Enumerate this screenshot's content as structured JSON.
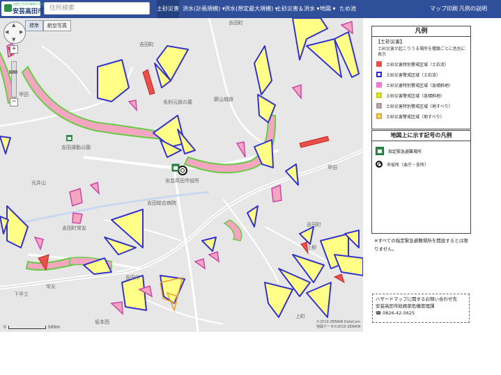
{
  "header": {
    "logo_subtitle": "自然と生活の調和する安芸高田市",
    "logo_text": "安芸高田市",
    "search_placeholder": "住所検索",
    "nav": [
      {
        "label": "土砂災害"
      },
      {
        "label": "洪水(計画規模) ▾"
      },
      {
        "label": "洪水(想定最大規模) ▾"
      },
      {
        "label": "土砂災害＆洪水 ▾"
      },
      {
        "label": "地図 ▾"
      },
      {
        "label": "ため池"
      }
    ],
    "right_nav": [
      {
        "label": "マップ印刷"
      },
      {
        "label": "凡例の説明"
      }
    ]
  },
  "map": {
    "basemap_tabs": [
      {
        "label": "標準"
      },
      {
        "label": "航空写真"
      }
    ],
    "zoom_in": "+",
    "zoom_out": "−",
    "labels": [
      {
        "text": "吉田町"
      },
      {
        "text": "甲田"
      },
      {
        "text": "毛利元就の墓"
      },
      {
        "text": "郡山城跡"
      },
      {
        "text": "吉田運動公園"
      },
      {
        "text": "安芸高田市役所"
      },
      {
        "text": "光井山"
      },
      {
        "text": "吉田総合病院"
      },
      {
        "text": "吉田町常友"
      },
      {
        "text": "吉田中"
      },
      {
        "text": "吉田町"
      },
      {
        "text": "下甲立"
      },
      {
        "text": "坂本西"
      },
      {
        "text": "吉田町"
      },
      {
        "text": "上柳"
      },
      {
        "text": "上町"
      },
      {
        "text": "常友"
      },
      {
        "text": "甲田"
      }
    ],
    "scale": {
      "left": "0",
      "right": "500m"
    },
    "attribution": [
      "©2019 ZENRIN DataCom",
      "地図データ©2019 ZENRIN"
    ]
  },
  "legend": {
    "title": "凡例",
    "category": "【土砂災害】",
    "description": "土砂災害が起こりうる場所を種類ごとに色別に表示",
    "items": [
      {
        "label": "土砂災害特別警戒区域（土石流）",
        "fill": "#e8504a",
        "border": "#e8504a"
      },
      {
        "label": "土砂災害警戒区域（土石流）",
        "fill": "#ffffff",
        "border": "#2b2bd6"
      },
      {
        "label": "土砂災害特別警戒区域（急傾斜地）",
        "fill": "#f07ad6",
        "border": "#f07ad6"
      },
      {
        "label": "土砂災害警戒区域（急傾斜地）",
        "fill": "#e6ef2a",
        "border": "#c6cf10"
      },
      {
        "label": "土砂災害特別警戒区域（地すべり）",
        "fill": "#e39ab0",
        "border": "#a0a0a0"
      },
      {
        "label": "土砂災害警戒区域（地すべり）",
        "fill": "#ffe58a",
        "border": "#e8a030"
      }
    ]
  },
  "symbols": {
    "title": "地図上に示す記号の凡例",
    "items": [
      {
        "label": "指定緊急避難場所",
        "icon": "shelter-icon"
      },
      {
        "label": "市役所（本庁・支所）",
        "icon": "cityhall-icon"
      }
    ]
  },
  "note": "※すべての指定緊急避難場所を開設するとは限りません。",
  "contact": {
    "title": "ハザードマップに関するお問い合わせ先",
    "department": "安芸高田市総務部危機管理課",
    "phone": "☎ 0826-42-5625"
  },
  "colors": {
    "header_bg": "#2f4f9a",
    "blue_zone_border": "#3333cc",
    "yellow_zone_fill": "#ffff88",
    "pink_zone_fill": "#f4a6c0",
    "green_zone_border": "#66cc44"
  }
}
